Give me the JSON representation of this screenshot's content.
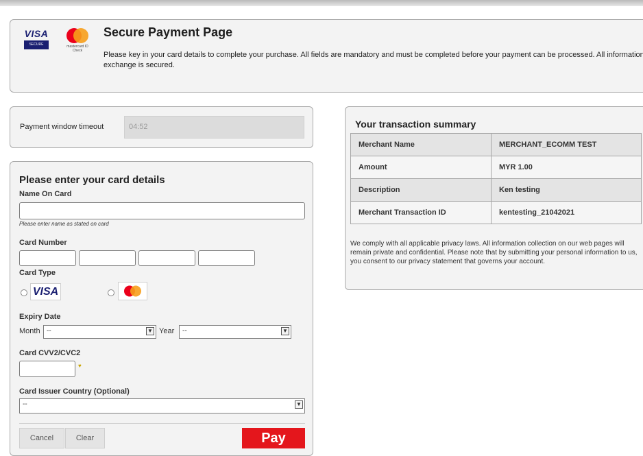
{
  "header": {
    "visa_brand": "VISA",
    "visa_secure": "SECURE",
    "mastercard_text": "mastercard ID Check",
    "title": "Secure Payment Page",
    "description": "Please key in your card details to complete your purchase. All fields are mandatory and must be completed before your payment can be processed. All information exchange is secured."
  },
  "timeout": {
    "label": "Payment window timeout",
    "value": "04:52"
  },
  "card_form": {
    "title": "Please enter your card details",
    "name_label": "Name On Card",
    "name_value": "",
    "name_hint": "Please enter name as stated on card",
    "number_label": "Card Number",
    "number_parts": [
      "",
      "",
      "",
      ""
    ],
    "type_label": "Card Type",
    "type_options": [
      {
        "name": "VISA",
        "icon": "visa-icon"
      },
      {
        "name": "Mastercard",
        "icon": "mastercard-icon"
      }
    ],
    "expiry_label": "Expiry Date",
    "month_label": "Month",
    "month_value": "--",
    "year_label": "Year",
    "year_value": "--",
    "cvv_label": "Card CVV2/CVC2",
    "cvv_value": "",
    "issuer_label": "Card Issuer Country (Optional)",
    "issuer_value": "--",
    "cancel_label": "Cancel",
    "clear_label": "Clear",
    "pay_label": "Pay"
  },
  "summary": {
    "title": "Your transaction summary",
    "rows": [
      {
        "key": "Merchant Name",
        "value": "MERCHANT_ECOMM TEST"
      },
      {
        "key": "Amount",
        "value": "MYR 1.00"
      },
      {
        "key": "Description",
        "value": "Ken testing"
      },
      {
        "key": "Merchant Transaction ID",
        "value": "kentesting_21042021"
      }
    ],
    "privacy": "We comply with all applicable privacy laws. All information collection on our web pages will remain private and confidential. Please note that by submitting your personal information to us, you consent to our privacy statement that governs your account."
  },
  "colors": {
    "pay_button": "#e4161c",
    "visa_blue": "#1a1f71",
    "mastercard_red": "#eb001b",
    "mastercard_orange": "#f79e1b"
  }
}
